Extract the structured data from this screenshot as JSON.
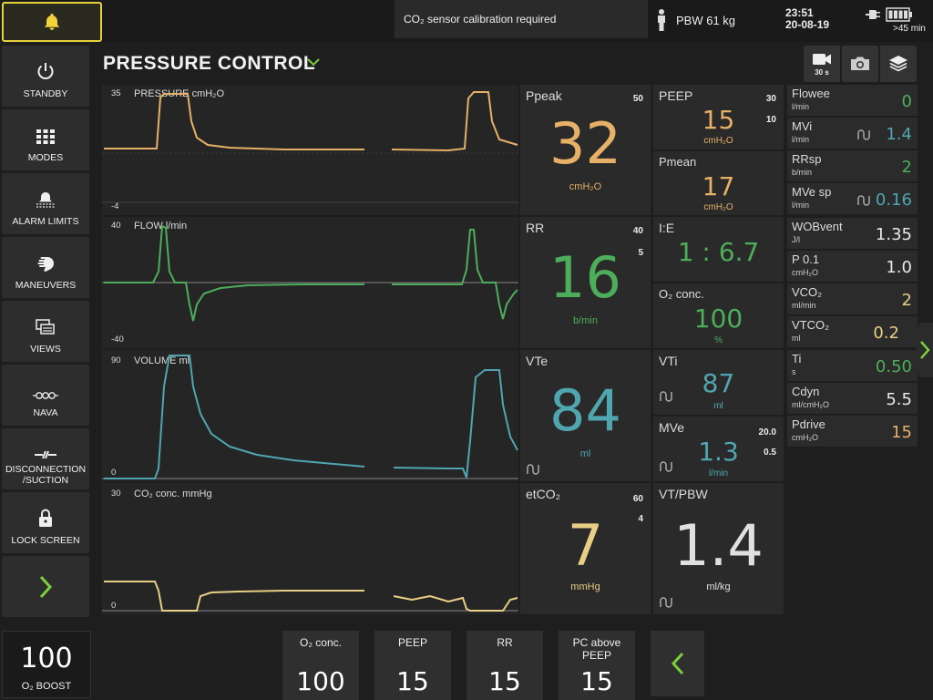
{
  "topbar": {
    "message": "CO₂ sensor calibration required",
    "pbw": "PBW 61 kg",
    "time": "23:51",
    "date": "20-08-19",
    "battery": ">45 min"
  },
  "menu": [
    {
      "label": "STANDBY",
      "icon": "power-icon"
    },
    {
      "label": "MODES",
      "icon": "grid-icon"
    },
    {
      "label": "ALARM LIMITS",
      "icon": "alarm-limits-icon"
    },
    {
      "label": "MANEUVERS",
      "icon": "hand-icon"
    },
    {
      "label": "VIEWS",
      "icon": "views-icon"
    },
    {
      "label": "NAVA",
      "icon": "nava-icon"
    },
    {
      "label": "DISCONNECTION\n/SUCTION",
      "icon": "disconnection-icon"
    },
    {
      "label": "LOCK SCREEN",
      "icon": "lock-icon"
    }
  ],
  "mode": {
    "title": "PRESSURE CONTROL"
  },
  "header_buttons": {
    "video_label": "30 s"
  },
  "waves": {
    "pressure": {
      "title": "PRESSURE cmH₂O",
      "ymax": "35",
      "ymin": "-4",
      "color": "#e6b066"
    },
    "flow": {
      "title": "FLOW l/min",
      "ymax": "40",
      "ymin": "-40",
      "color": "#4cae5a"
    },
    "volume": {
      "title": "VOLUME ml",
      "ymax": "90",
      "ymin": "0",
      "color": "#4fa6b0"
    },
    "co2": {
      "title": "CO₂ conc. mmHg",
      "ymax": "30",
      "ymin": "0",
      "color": "#e8cf85"
    }
  },
  "values": {
    "ppeak": {
      "name": "Ppeak",
      "value": "32",
      "unit": "cmH₂O",
      "hi": "50",
      "color": "#e6b066"
    },
    "peep": {
      "name": "PEEP",
      "value": "15",
      "unit": "cmH₂O",
      "hi": "30",
      "lo": "10",
      "color": "#e6b066"
    },
    "pmean": {
      "name": "Pmean",
      "value": "17",
      "unit": "cmH₂O",
      "color": "#e6b066"
    },
    "rr": {
      "name": "RR",
      "value": "16",
      "unit": "b/min",
      "hi": "40",
      "lo": "5",
      "color": "#4cae5a"
    },
    "ie": {
      "name": "I:E",
      "value": "1 : 6.7",
      "color": "#4cae5a"
    },
    "o2": {
      "name": "O₂ conc.",
      "value": "100",
      "unit": "%",
      "color": "#4cae5a"
    },
    "vte": {
      "name": "VTe",
      "value": "84",
      "unit": "ml",
      "color": "#4fa6b0"
    },
    "vti": {
      "name": "VTi",
      "value": "87",
      "unit": "ml",
      "color": "#4fa6b0"
    },
    "mve": {
      "name": "MVe",
      "value": "1.3",
      "unit": "l/min",
      "hi": "20.0",
      "lo": "0.5",
      "color": "#4fa6b0"
    },
    "etco2": {
      "name": "etCO₂",
      "value": "7",
      "unit": "mmHg",
      "hi": "60",
      "lo": "4",
      "color": "#e8cf85"
    },
    "vtpbw": {
      "name": "VT/PBW",
      "value": "1.4",
      "unit": "ml/kg",
      "color": "#e0e0e0"
    }
  },
  "side_values": [
    {
      "name": "Flowee",
      "unit": "l/min",
      "value": "0",
      "color": "#4cae5a"
    },
    {
      "name": "MVi",
      "unit": "l/min",
      "value": "1.4",
      "color": "#4fa6b0",
      "loop": true
    },
    {
      "name": "RRsp",
      "unit": "b/min",
      "value": "2",
      "color": "#4cae5a"
    },
    {
      "name": "MVe sp",
      "unit": "l/min",
      "value": "0.16",
      "color": "#4fa6b0",
      "loop": true
    },
    {
      "name": "WOBvent",
      "unit": "J/l",
      "value": "1.35",
      "color": "#e8e8e8"
    },
    {
      "name": "P 0.1",
      "unit": "cmH₂O",
      "value": "1.0",
      "color": "#e8e8e8"
    },
    {
      "name": "VCO₂",
      "unit": "ml/min",
      "value": "2",
      "color": "#e8cf85"
    },
    {
      "name": "VTCO₂",
      "unit": "ml",
      "value": "0.2",
      "color": "#e8cf85"
    },
    {
      "name": "Ti",
      "unit": "s",
      "value": "0.50",
      "color": "#4cae5a"
    },
    {
      "name": "Cdyn",
      "unit": "ml/cmH₂O",
      "value": "5.5",
      "color": "#e8e8e8"
    },
    {
      "name": "Pdrive",
      "unit": "cmH₂O",
      "value": "15",
      "color": "#e6b066"
    }
  ],
  "bottom": {
    "o2boost_value": "100",
    "o2boost_label": "O₂ BOOST",
    "settings": [
      {
        "label": "O₂ conc.",
        "value": "100"
      },
      {
        "label": "PEEP",
        "value": "15"
      },
      {
        "label": "RR",
        "value": "15"
      },
      {
        "label": "PC above\nPEEP",
        "value": "15"
      }
    ]
  }
}
